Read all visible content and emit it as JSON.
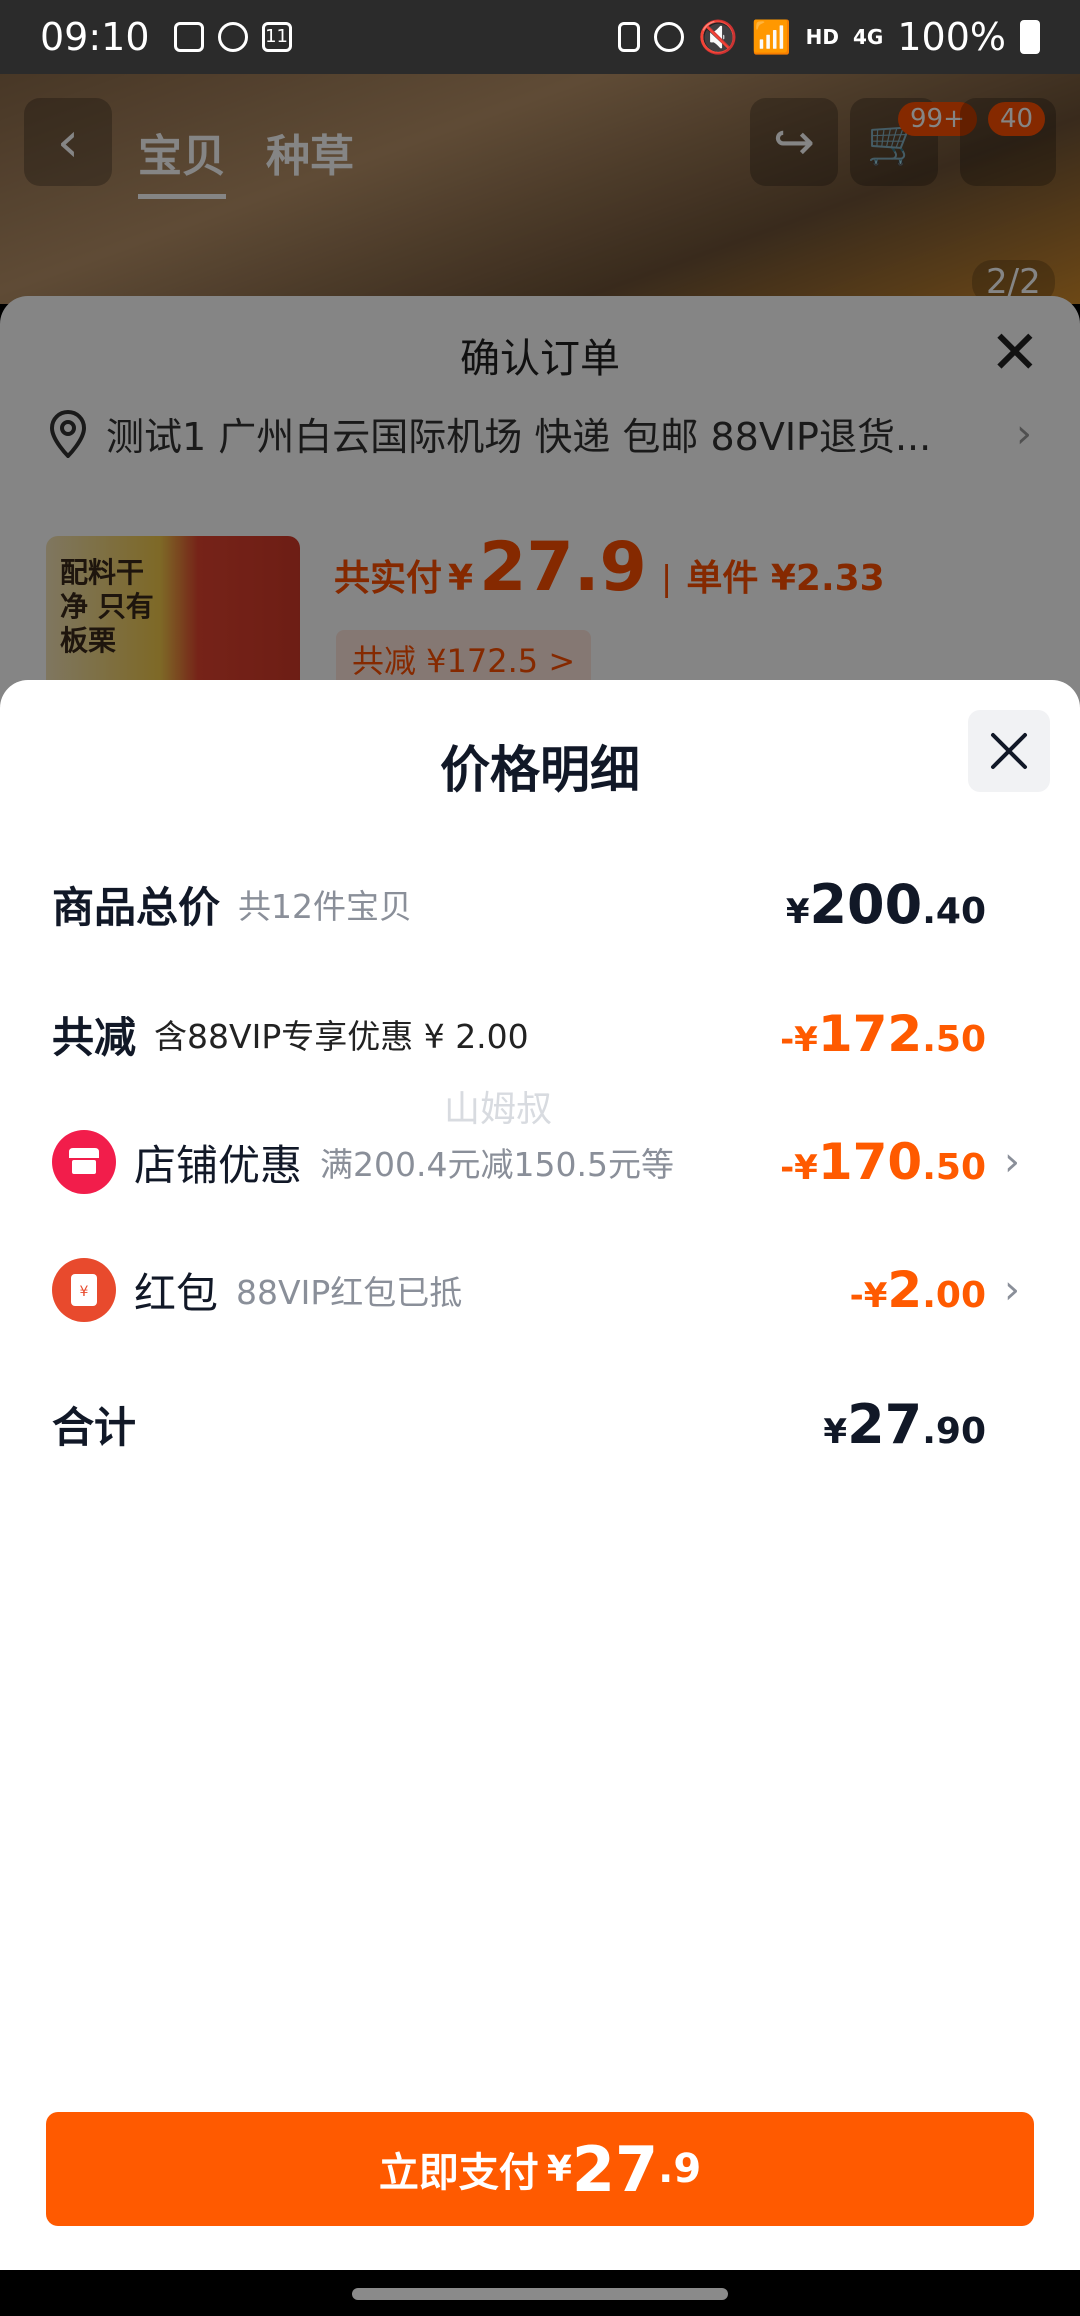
{
  "status_bar": {
    "time": "09:10",
    "battery": "100%",
    "network": "4G",
    "hd": "HD",
    "calendar_day": "11"
  },
  "product_header": {
    "tabs": [
      "宝贝",
      "种草"
    ],
    "cart_badge": "99+",
    "message_badge": "40",
    "pager": "2/2"
  },
  "confirm_order": {
    "title": "确认订单",
    "address_text": "测试1 广州白云国际机场  快递 包邮 88VIP退货...",
    "thumb_text": "配料干净 只有板栗",
    "actual_pay_label": "共实付",
    "actual_pay_yen": "¥",
    "actual_pay_value": "27.9",
    "separator": "|",
    "unit_price": "单件 ¥2.33",
    "saving_chip": "共减 ¥172.5 >"
  },
  "price_detail": {
    "title": "价格明细",
    "rows": {
      "goods_total": {
        "label": "商品总价",
        "sub": "共12件宝贝",
        "yen": "¥",
        "int": "200",
        "dec": ".40"
      },
      "total_discount": {
        "label": "共减",
        "sub": "含88VIP专享优惠 ¥ 2.00",
        "yen": "-¥",
        "int": "172",
        "dec": ".50"
      },
      "shop_discount": {
        "label": "店铺优惠",
        "sub": "满200.4元减150.5元等",
        "yen": "-¥",
        "int": "170",
        "dec": ".50"
      },
      "red_packet": {
        "label": "红包",
        "sub": "88VIP红包已抵",
        "yen": "-¥",
        "int": "2",
        "dec": ".00"
      },
      "sum": {
        "label": "合计",
        "yen": "¥",
        "int": "27",
        "dec": ".90"
      }
    },
    "watermark": "山姆叔"
  },
  "pay_button": {
    "label": "立即支付",
    "yen": "¥",
    "int": "27",
    "dec": ".9"
  },
  "colors": {
    "accent": "#ff5a00",
    "shop_icon": "#f21d4b",
    "red_packet_icon": "#e84a2d"
  }
}
